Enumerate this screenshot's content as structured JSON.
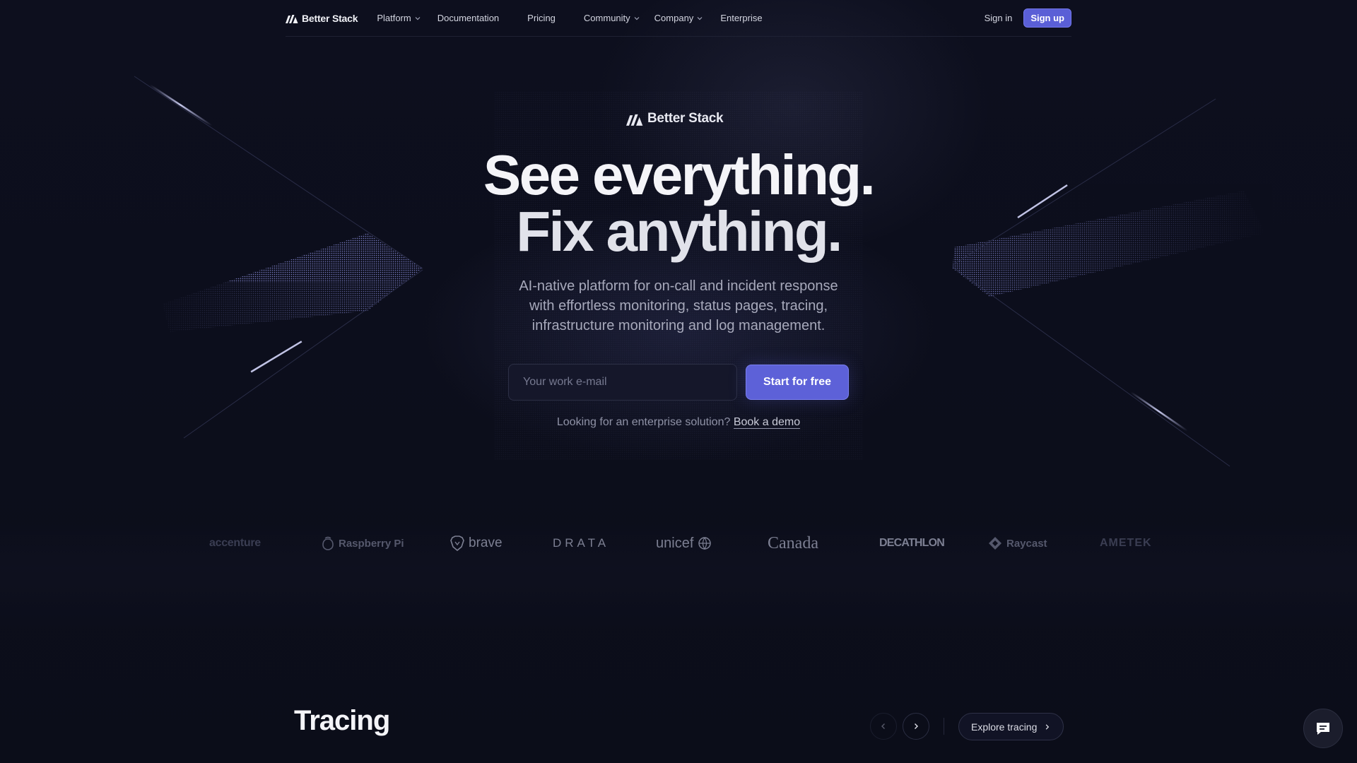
{
  "brand": {
    "name": "Better Stack"
  },
  "nav": {
    "items": [
      {
        "label": "Platform",
        "has_dropdown": true
      },
      {
        "label": "Documentation",
        "has_dropdown": false
      },
      {
        "label": "Pricing",
        "has_dropdown": false
      },
      {
        "label": "Community",
        "has_dropdown": true
      },
      {
        "label": "Company",
        "has_dropdown": true
      },
      {
        "label": "Enterprise",
        "has_dropdown": false
      }
    ],
    "signin_label": "Sign in",
    "signup_label": "Sign up"
  },
  "hero": {
    "logo_text": "Better Stack",
    "headline_line1": "See everything.",
    "headline_line2": "Fix anything.",
    "subhead_line1": "AI-native platform for on-call and incident response",
    "subhead_line2": "with effortless monitoring, status pages, tracing,",
    "subhead_line3": "infrastructure monitoring and log management.",
    "email_placeholder": "Your work e-mail",
    "email_value": "",
    "cta_label": "Start for free",
    "demo_prompt": "Looking for an enterprise solution?",
    "demo_link": "Book a demo"
  },
  "customer_logos": [
    {
      "name": "accenture",
      "icon": "accenture-logo"
    },
    {
      "name": "Raspberry Pi",
      "icon": "raspberry-pi-logo"
    },
    {
      "name": "brave",
      "icon": "brave-lion-logo"
    },
    {
      "name": "DRATA",
      "icon": "drata-logo"
    },
    {
      "name": "unicef",
      "icon": "unicef-globe-logo"
    },
    {
      "name": "Canada",
      "icon": "canada-wordmark-logo"
    },
    {
      "name": "DECATHLON",
      "icon": "decathlon-logo"
    },
    {
      "name": "Raycast",
      "icon": "raycast-logo"
    },
    {
      "name": "AMETEK",
      "icon": "ametek-logo"
    }
  ],
  "section": {
    "title": "Tracing",
    "explore_label": "Explore tracing",
    "prev_icon": "chevron-left-icon",
    "next_icon": "chevron-right-icon"
  },
  "chat_icon": "chat-bubble-icon",
  "colors": {
    "background": "#0c0e1c",
    "accent": "#5d61d8",
    "text_primary": "#f4f4f8",
    "text_muted": "#a7a9bb"
  }
}
